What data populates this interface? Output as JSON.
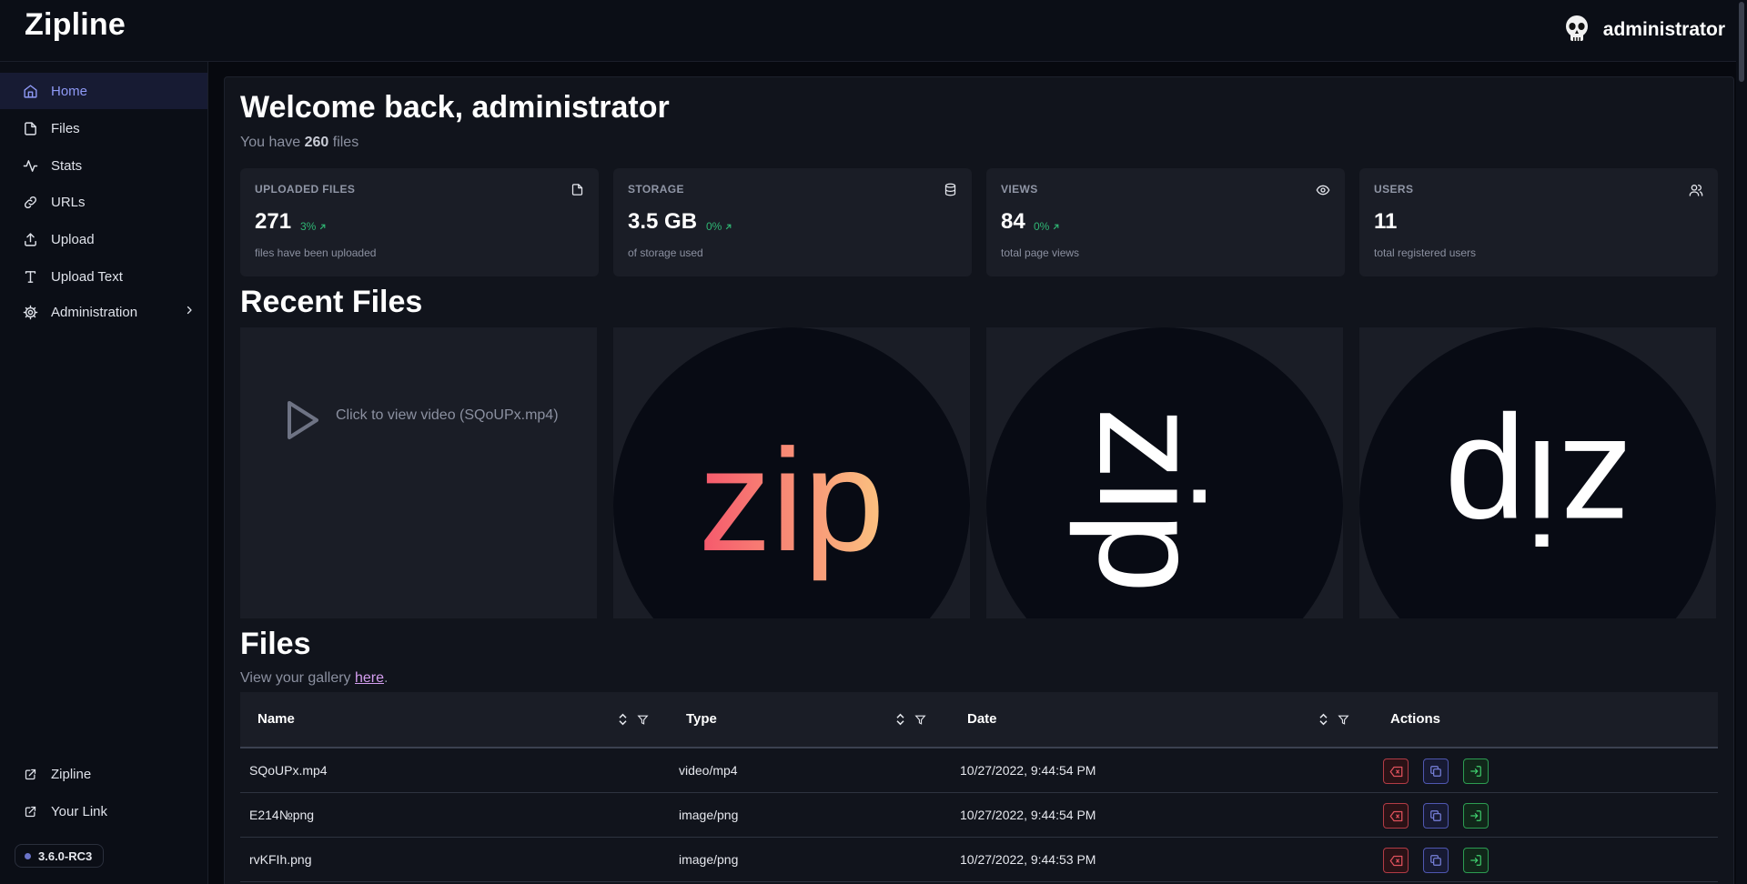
{
  "app": {
    "brand": "Zipline",
    "username": "administrator"
  },
  "sidebar": {
    "items": [
      {
        "label": "Home",
        "icon": "home-icon",
        "active": true
      },
      {
        "label": "Files",
        "icon": "file-icon"
      },
      {
        "label": "Stats",
        "icon": "activity-icon"
      },
      {
        "label": "URLs",
        "icon": "link-icon"
      },
      {
        "label": "Upload",
        "icon": "upload-icon"
      },
      {
        "label": "Upload Text",
        "icon": "type-icon"
      },
      {
        "label": "Administration",
        "icon": "gear-icon",
        "expandable": true
      }
    ],
    "footer_links": [
      {
        "label": "Zipline",
        "icon": "external-link-icon"
      },
      {
        "label": "Your Link",
        "icon": "external-link-icon"
      }
    ],
    "version": "3.6.0-RC3"
  },
  "welcome": {
    "title": "Welcome back, administrator",
    "files_prefix": "You have",
    "files_count": "260",
    "files_suffix": "files"
  },
  "stats": [
    {
      "label": "UPLOADED FILES",
      "value": "271",
      "change": "3%",
      "desc": "files have been uploaded",
      "icon": "file-icon"
    },
    {
      "label": "STORAGE",
      "value": "3.5 GB",
      "change": "0%",
      "desc": "of storage used",
      "icon": "database-icon"
    },
    {
      "label": "VIEWS",
      "value": "84",
      "change": "0%",
      "desc": "total page views",
      "icon": "eye-icon"
    },
    {
      "label": "USERS",
      "value": "11",
      "change": "",
      "desc": "total registered users",
      "icon": "users-icon"
    }
  ],
  "recent": {
    "title": "Recent Files",
    "video_label": "Click to view video (SQoUPx.mp4)",
    "logo_text": "zip"
  },
  "files_section": {
    "title": "Files",
    "gallery_prefix": "View your gallery",
    "gallery_link": "here",
    "gallery_suffix": "."
  },
  "table": {
    "columns": [
      "Name",
      "Type",
      "Date",
      "Actions"
    ],
    "rows": [
      {
        "name": "SQoUPx.mp4",
        "type": "video/mp4",
        "date": "10/27/2022, 9:44:54 PM"
      },
      {
        "name": "E214№png",
        "type": "image/png",
        "date": "10/27/2022, 9:44:54 PM"
      },
      {
        "name": "rvKFIh.png",
        "type": "image/png",
        "date": "10/27/2022, 9:44:53 PM"
      }
    ]
  },
  "colors": {
    "accent": "#8e99f5",
    "success": "#2fb573",
    "danger": "#e0525d",
    "logo_gradient_start": "#f5576c",
    "logo_gradient_end": "#fbc380"
  }
}
